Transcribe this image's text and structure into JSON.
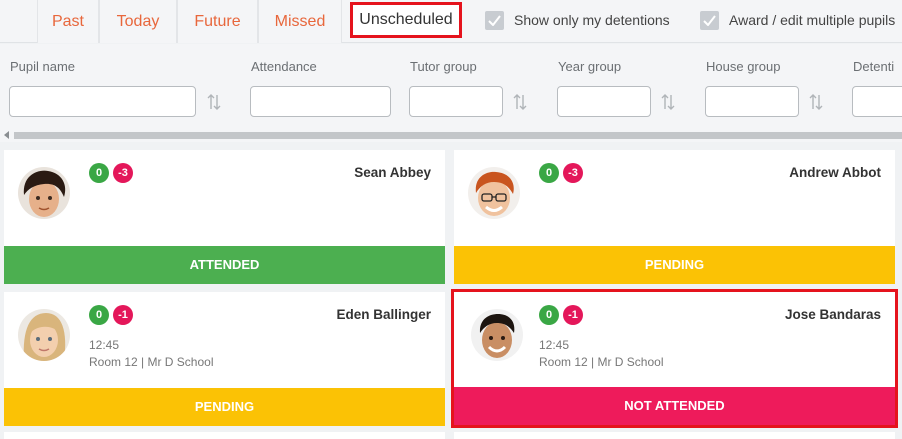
{
  "tabs": [
    "Past",
    "Today",
    "Future",
    "Missed",
    "Unscheduled"
  ],
  "checks": {
    "only_mine": "Show only my detentions",
    "multi": "Award / edit multiple pupils"
  },
  "filters": {
    "pupil_name": "Pupil name",
    "attendance": "Attendance",
    "tutor_group": "Tutor group",
    "year_group": "Year group",
    "house_group": "House group",
    "detention": "Detenti"
  },
  "cards": [
    {
      "name": "Sean Abbey",
      "pos": "0",
      "neg": "-3",
      "time": "",
      "room": "",
      "status": "ATTENDED"
    },
    {
      "name": "Andrew Abbot",
      "pos": "0",
      "neg": "-3",
      "time": "",
      "room": "",
      "status": "PENDING"
    },
    {
      "name": "Eden Ballinger",
      "pos": "0",
      "neg": "-1",
      "time": "12:45",
      "room": "Room 12 | Mr D School",
      "status": "PENDING"
    },
    {
      "name": "Jose Bandaras",
      "pos": "0",
      "neg": "-1",
      "time": "12:45",
      "room": "Room 12 | Mr D School",
      "status": "NOT ATTENDED"
    }
  ],
  "colors": {
    "tab_text": "#e8673c",
    "highlight": "#e5131d",
    "attended": "#4caf50",
    "pending": "#fbc205",
    "not_attended": "#ee1b5b"
  }
}
